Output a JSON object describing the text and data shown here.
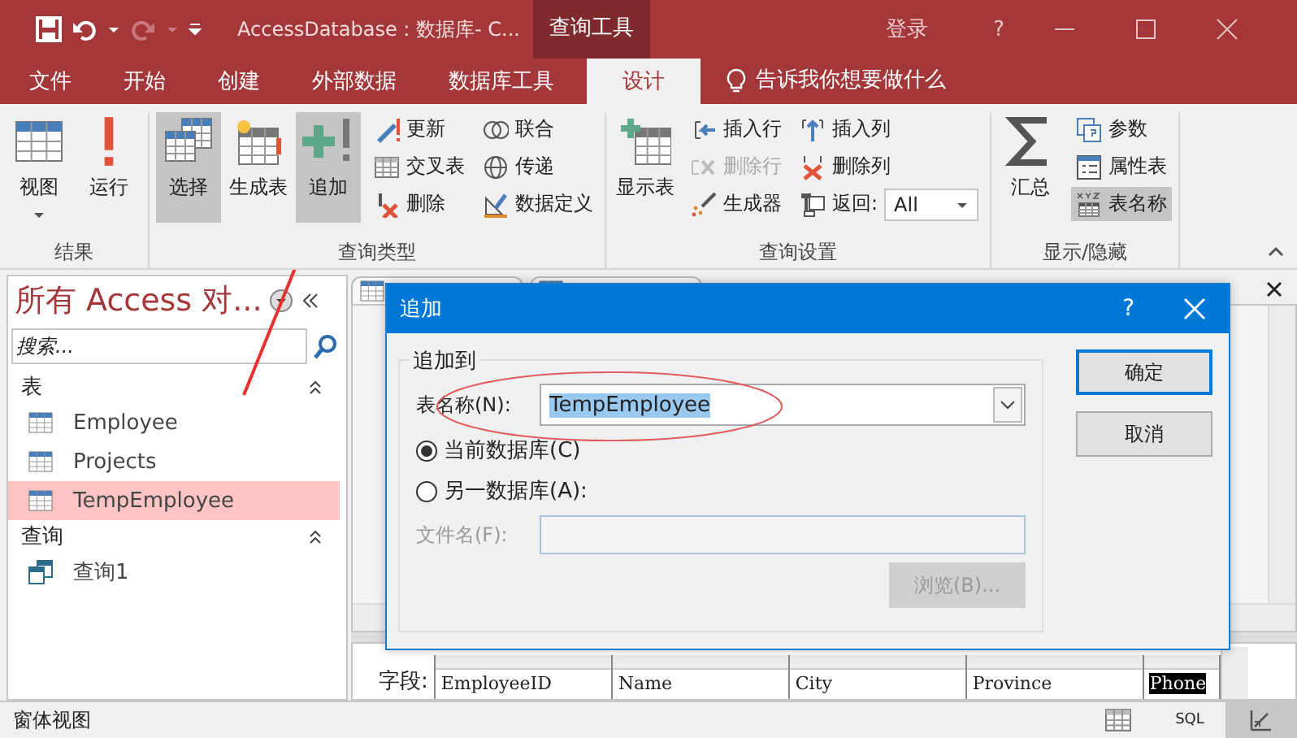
{
  "title_bar": {
    "title": "AccessDatabase : 数据库- C...",
    "context_tab": "查询工具",
    "sign_in": "登录",
    "help": "?"
  },
  "menu_tabs": [
    {
      "label": "文件",
      "selected": false
    },
    {
      "label": "开始",
      "selected": false
    },
    {
      "label": "创建",
      "selected": false
    },
    {
      "label": "外部数据",
      "selected": false
    },
    {
      "label": "数据库工具",
      "selected": false
    },
    {
      "label": "设计",
      "selected": true
    }
  ],
  "tell_me": "告诉我你想要做什么",
  "ribbon": {
    "groups": [
      {
        "label": "结果",
        "controls": [
          {
            "kind": "split",
            "label": "视图",
            "selected": false,
            "disabled": false
          },
          {
            "kind": "large",
            "label": "运行",
            "selected": false,
            "disabled": false
          }
        ]
      },
      {
        "label": "查询类型",
        "controls": [
          {
            "kind": "large",
            "label": "选择",
            "selected": true,
            "disabled": false
          },
          {
            "kind": "large",
            "label": "生成表",
            "selected": false,
            "disabled": false
          },
          {
            "kind": "large",
            "label": "追加",
            "selected": true,
            "disabled": false
          },
          {
            "kind": "small",
            "label": "更新",
            "selected": false,
            "disabled": false
          },
          {
            "kind": "small",
            "label": "交叉表",
            "selected": false,
            "disabled": false
          },
          {
            "kind": "small",
            "label": "删除",
            "selected": false,
            "disabled": false
          },
          {
            "kind": "small",
            "label": "联合",
            "selected": false,
            "disabled": false
          },
          {
            "kind": "small",
            "label": "传递",
            "selected": false,
            "disabled": false
          },
          {
            "kind": "small",
            "label": "数据定义",
            "selected": false,
            "disabled": false
          }
        ]
      },
      {
        "label": "查询设置",
        "controls": [
          {
            "kind": "large",
            "label": "显示表",
            "selected": false,
            "disabled": false
          },
          {
            "kind": "small",
            "label": "插入行",
            "selected": false,
            "disabled": false
          },
          {
            "kind": "small",
            "label": "删除行",
            "selected": false,
            "disabled": true
          },
          {
            "kind": "small",
            "label": "生成器",
            "selected": false,
            "disabled": false
          },
          {
            "kind": "small",
            "label": "插入列",
            "selected": false,
            "disabled": false
          },
          {
            "kind": "small",
            "label": "删除列",
            "selected": false,
            "disabled": false
          },
          {
            "kind": "dropdown",
            "label": "返回:",
            "value": "All",
            "selected": false,
            "disabled": false
          }
        ]
      },
      {
        "label": "显示/隐藏",
        "controls": [
          {
            "kind": "large",
            "label": "汇总",
            "selected": false,
            "disabled": false
          },
          {
            "kind": "small",
            "label": "参数",
            "selected": false,
            "disabled": false
          },
          {
            "kind": "small",
            "label": "属性表",
            "selected": false,
            "disabled": false
          },
          {
            "kind": "small",
            "label": "表名称",
            "selected": true,
            "disabled": false
          }
        ]
      }
    ]
  },
  "nav_pane": {
    "title": "所有 Access 对...",
    "search": {
      "placeholder": "搜索..."
    },
    "sections": [
      {
        "label": "表",
        "kind": "table",
        "items": [
          {
            "label": "Employee",
            "selected": false
          },
          {
            "label": "Projects",
            "selected": false
          },
          {
            "label": "TempEmployee",
            "selected": true
          }
        ]
      },
      {
        "label": "查询",
        "kind": "query",
        "items": [
          {
            "label": "查询1",
            "selected": false
          }
        ]
      }
    ]
  },
  "dialog": {
    "title": "追加",
    "help": "?",
    "group_label": "追加到",
    "table_name_label": "表名称(N):",
    "table_name": "TempEmployee",
    "options": [
      {
        "label": "当前数据库(C)",
        "selected": true
      },
      {
        "label": "另一数据库(A):",
        "selected": false
      }
    ],
    "file_label": "文件名(F):",
    "browse": {
      "label": "浏览(B)...",
      "disabled": true
    },
    "ok": "确定",
    "cancel": "取消"
  },
  "design_grid": {
    "row_label": "字段:",
    "fields": [
      {
        "label": "EmployeeID",
        "selected": false
      },
      {
        "label": "Name",
        "selected": false
      },
      {
        "label": "City",
        "selected": false
      },
      {
        "label": "Province",
        "selected": false
      },
      {
        "label": "Phone",
        "selected": true
      }
    ]
  },
  "status_bar": {
    "text": "窗体视图",
    "views": [
      {
        "kind": "datasheet",
        "selected": false
      },
      {
        "kind": "sql",
        "label": "SQL",
        "selected": false
      },
      {
        "kind": "design",
        "selected": true
      }
    ]
  }
}
